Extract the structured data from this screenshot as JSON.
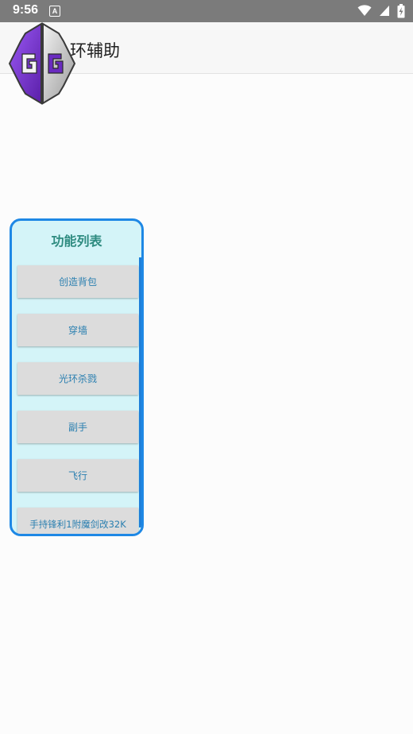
{
  "status_bar": {
    "time": "9:56",
    "notification_letter": "A"
  },
  "app": {
    "title": "环辅助",
    "logo_text": "GG"
  },
  "panel": {
    "title": "功能列表",
    "buttons": [
      {
        "label": "创造背包"
      },
      {
        "label": "穿墙"
      },
      {
        "label": "光环杀戮"
      },
      {
        "label": "副手"
      },
      {
        "label": "飞行"
      },
      {
        "label": "手持锋利1附魔剑改32K"
      }
    ]
  },
  "colors": {
    "status_bar": "#7b7b7b",
    "panel_border": "#1e88e5",
    "panel_bg": "#d4f4f8",
    "panel_title": "#2e8b80",
    "button_text": "#2a7fb0",
    "button_bg": "#dcdcdc"
  }
}
